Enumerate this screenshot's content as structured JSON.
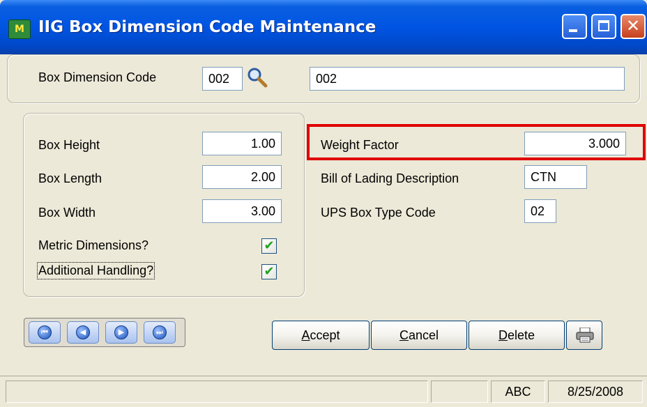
{
  "window": {
    "title": "IIG Box Dimension Code Maintenance",
    "app_icon_text": "M"
  },
  "header": {
    "code_label": "Box Dimension Code",
    "code_value": "002",
    "description_value": "002"
  },
  "dimensions": {
    "height_label": "Box Height",
    "height_value": "1.00",
    "length_label": "Box Length",
    "length_value": "2.00",
    "width_label": "Box Width",
    "width_value": "3.00",
    "metric_label": "Metric Dimensions?",
    "metric_checked": true,
    "handling_label": "Additional Handling?",
    "handling_checked": true
  },
  "shipping": {
    "weight_label": "Weight Factor",
    "weight_value": "3.000",
    "bol_label": "Bill of Lading Description",
    "bol_value": "CTN",
    "ups_label": "UPS Box Type Code",
    "ups_value": "02"
  },
  "buttons": {
    "accept": {
      "hotkey": "A",
      "rest": "ccept"
    },
    "cancel": {
      "hotkey": "C",
      "rest": "ancel"
    },
    "delete": {
      "hotkey": "D",
      "rest": "elete"
    }
  },
  "status": {
    "cell1": "",
    "cell2": "",
    "company": "ABC",
    "date": "8/25/2008"
  },
  "colors": {
    "highlight": "#e00000",
    "titlebar": "#0054e3"
  }
}
